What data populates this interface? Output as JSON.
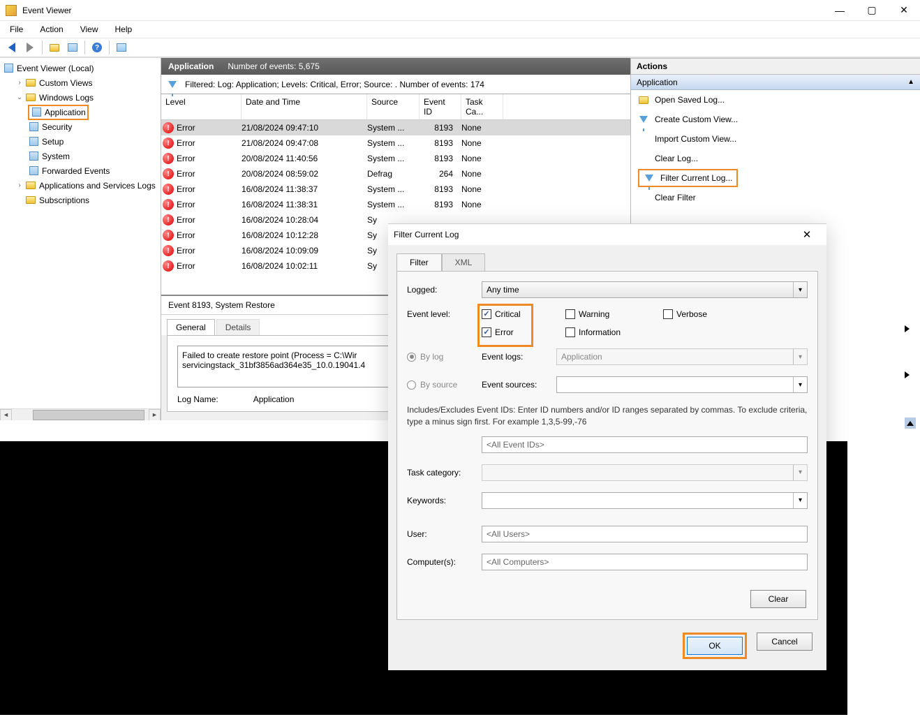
{
  "window": {
    "title": "Event Viewer",
    "menu": [
      "File",
      "Action",
      "View",
      "Help"
    ]
  },
  "tree": {
    "root": "Event Viewer (Local)",
    "custom_views": "Custom Views",
    "windows_logs": "Windows Logs",
    "logs": [
      "Application",
      "Security",
      "Setup",
      "System",
      "Forwarded Events"
    ],
    "apps_services": "Applications and Services Logs",
    "subscriptions": "Subscriptions"
  },
  "mid": {
    "title": "Application",
    "count_label": "Number of events: 5,675",
    "filter_text": "Filtered: Log: Application; Levels: Critical, Error; Source: . Number of events: 174",
    "columns": [
      "Level",
      "Date and Time",
      "Source",
      "Event ID",
      "Task Ca..."
    ],
    "rows": [
      {
        "level": "Error",
        "date": "21/08/2024 09:47:10",
        "src": "System ...",
        "id": "8193",
        "task": "None"
      },
      {
        "level": "Error",
        "date": "21/08/2024 09:47:08",
        "src": "System ...",
        "id": "8193",
        "task": "None"
      },
      {
        "level": "Error",
        "date": "20/08/2024 11:40:56",
        "src": "System ...",
        "id": "8193",
        "task": "None"
      },
      {
        "level": "Error",
        "date": "20/08/2024 08:59:02",
        "src": "Defrag",
        "id": "264",
        "task": "None"
      },
      {
        "level": "Error",
        "date": "16/08/2024 11:38:37",
        "src": "System ...",
        "id": "8193",
        "task": "None"
      },
      {
        "level": "Error",
        "date": "16/08/2024 11:38:31",
        "src": "System ...",
        "id": "8193",
        "task": "None"
      },
      {
        "level": "Error",
        "date": "16/08/2024 10:28:04",
        "src": "Sy",
        "id": "",
        "task": ""
      },
      {
        "level": "Error",
        "date": "16/08/2024 10:12:28",
        "src": "Sy",
        "id": "",
        "task": ""
      },
      {
        "level": "Error",
        "date": "16/08/2024 10:09:09",
        "src": "Sy",
        "id": "",
        "task": ""
      },
      {
        "level": "Error",
        "date": "16/08/2024 10:02:11",
        "src": "Sy",
        "id": "",
        "task": ""
      }
    ],
    "detail_title": "Event 8193, System Restore",
    "detail_tabs": [
      "General",
      "Details"
    ],
    "detail_text": "Failed to create restore point (Process = C:\\Wir\nservicingstack_31bf3856ad364e35_10.0.19041.4",
    "detail_logname_label": "Log Name:",
    "detail_logname_value": "Application"
  },
  "actions": {
    "header": "Actions",
    "section": "Application",
    "items": [
      "Open Saved Log...",
      "Create Custom View...",
      "Import Custom View...",
      "Clear Log...",
      "Filter Current Log...",
      "Clear Filter"
    ]
  },
  "dialog": {
    "title": "Filter Current Log",
    "tabs": [
      "Filter",
      "XML"
    ],
    "logged_label": "Logged:",
    "logged_value": "Any time",
    "level_label": "Event level:",
    "levels": {
      "critical": "Critical",
      "warning": "Warning",
      "verbose": "Verbose",
      "error": "Error",
      "information": "Information"
    },
    "by_log": "By log",
    "by_source": "By source",
    "event_logs_label": "Event logs:",
    "event_logs_value": "Application",
    "event_sources_label": "Event sources:",
    "hint": "Includes/Excludes Event IDs: Enter ID numbers and/or ID ranges separated by commas. To exclude criteria, type a minus sign first. For example 1,3,5-99,-76",
    "event_ids_placeholder": "<All Event IDs>",
    "task_category_label": "Task category:",
    "keywords_label": "Keywords:",
    "user_label": "User:",
    "user_value": "<All Users>",
    "computers_label": "Computer(s):",
    "computers_value": "<All Computers>",
    "clear": "Clear",
    "ok": "OK",
    "cancel": "Cancel"
  }
}
